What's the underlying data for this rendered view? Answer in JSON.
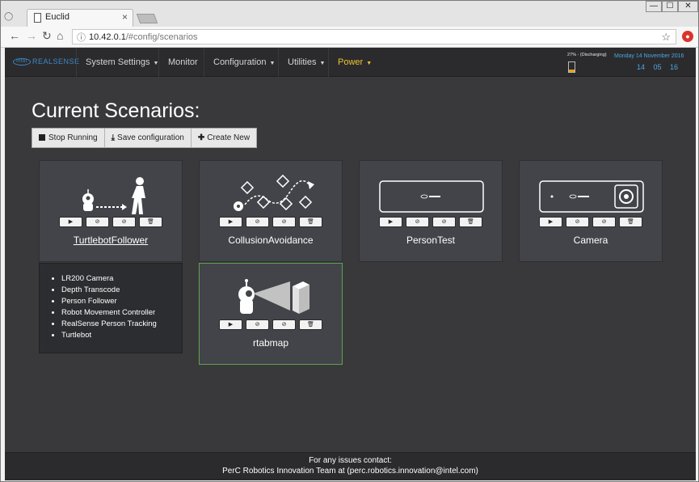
{
  "browser": {
    "tab_title": "Euclid",
    "tab_close": "×",
    "url_host": "10.42.0.1",
    "url_path": "/#config/scenarios",
    "window_buttons": {
      "minimize": "—",
      "maximize": "☐",
      "close": "✕"
    }
  },
  "navbar": {
    "brand": "REALSENSE",
    "items": [
      {
        "label": "System Settings",
        "has_caret": true
      },
      {
        "label": "Monitor",
        "has_caret": false
      },
      {
        "label": "Configuration",
        "has_caret": true
      },
      {
        "label": "Utilities",
        "has_caret": true
      },
      {
        "label": "Power",
        "has_caret": true
      }
    ],
    "battery_text": "27% - (Discharging)",
    "battery_level": 0.27,
    "date": "Monday 14 November 2016",
    "time": "14 05 16",
    "accent_color": "#f1c232",
    "clock_color": "#4aa7e0"
  },
  "page": {
    "title": "Current Scenarios:",
    "toolbar": {
      "stop_running": "Stop Running",
      "save_configuration": "Save configuration",
      "create_new": "Create New"
    }
  },
  "scenarios": [
    {
      "name": "TurtlebotFollower",
      "link": true,
      "icon": "robot-following-person"
    },
    {
      "name": "CollusionAvoidance",
      "link": false,
      "icon": "robot-path-obstacles"
    },
    {
      "name": "PersonTest",
      "link": false,
      "icon": "realsense-camera"
    },
    {
      "name": "Camera",
      "link": false,
      "icon": "realsense-camera-lens"
    },
    {
      "name": "rtabmap",
      "link": false,
      "icon": "robot-scanning-box",
      "selected": true
    }
  ],
  "scenario_controls": [
    "▶",
    "⊘",
    "⊘",
    "🗑"
  ],
  "turtlebot_details": [
    "LR200 Camera",
    "Depth Transcode",
    "Person Follower",
    "Robot Movement Controller",
    "RealSense Person Tracking",
    "Turtlebot"
  ],
  "footer": {
    "line1": "For any issues contact:",
    "line2": "PerC Robotics Innovation Team at (perc.robotics.innovation@intel.com)"
  }
}
